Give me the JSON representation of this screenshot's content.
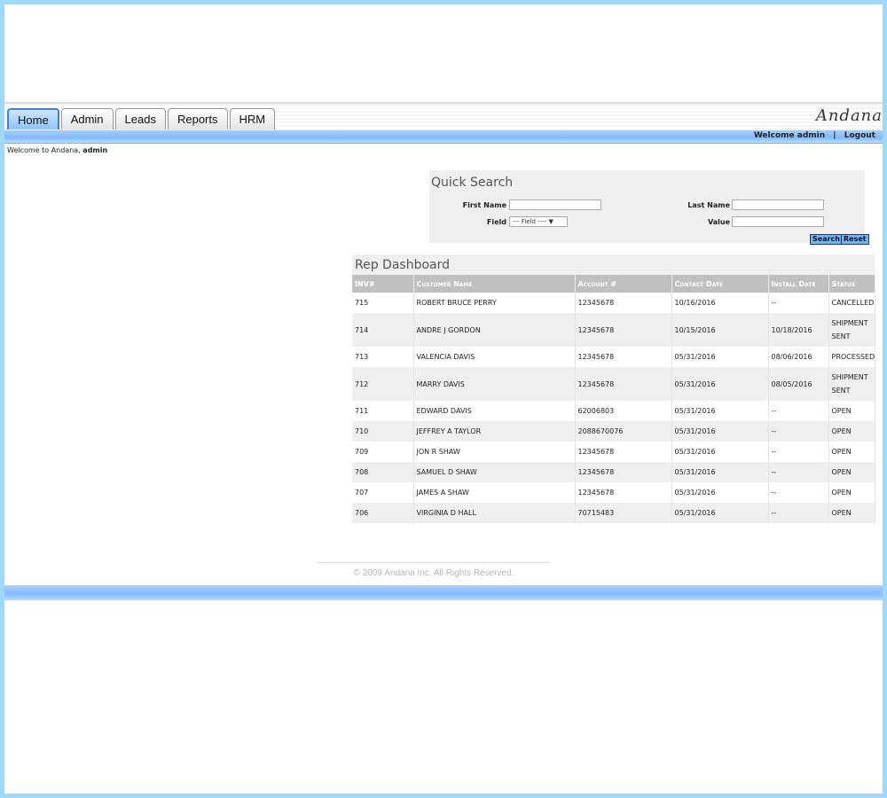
{
  "tabs": [
    {
      "label": "Home",
      "active": true
    },
    {
      "label": "Admin",
      "active": false
    },
    {
      "label": "Leads",
      "active": false
    },
    {
      "label": "Reports",
      "active": false
    },
    {
      "label": "HRM",
      "active": false
    }
  ],
  "logo": "Andana",
  "user": {
    "welcome": "Welcome admin",
    "separator": "|",
    "logout": "Logout"
  },
  "welcome_line": {
    "prefix": "Welcome to Andana,",
    "user": "admin"
  },
  "quick_search": {
    "title": "Quick Search",
    "first_name_label": "First Name",
    "first_name_value": "",
    "last_name_label": "Last Name",
    "last_name_value": "",
    "field_label": "Field",
    "field_selected": "--- Field ---- ▼",
    "value_label": "Value",
    "value_value": "",
    "search_button": "Search",
    "reset_button": "Reset"
  },
  "dashboard": {
    "title": "Rep Dashboard",
    "columns": [
      "INV#",
      "Customer Name",
      "Account #",
      "Contact Date",
      "Install Date",
      "Status"
    ],
    "rows": [
      [
        "715",
        "ROBERT BRUCE PERRY",
        "12345678",
        "10/16/2016",
        "--",
        "CANCELLED"
      ],
      [
        "714",
        "ANDRE J GORDON",
        "12345678",
        "10/15/2016",
        "10/18/2016",
        "SHIPMENT SENT"
      ],
      [
        "713",
        "VALENCIA DAVIS",
        "12345678",
        "05/31/2016",
        "08/06/2016",
        "PROCESSED"
      ],
      [
        "712",
        "MARRY DAVIS",
        "12345678",
        "05/31/2016",
        "08/05/2016",
        "SHIPMENT SENT"
      ],
      [
        "711",
        "EDWARD DAVIS",
        "62006803",
        "05/31/2016",
        "--",
        "OPEN"
      ],
      [
        "710",
        "JEFFREY A TAYLOR",
        "2088670076",
        "05/31/2016",
        "--",
        "OPEN"
      ],
      [
        "709",
        "JON R SHAW",
        "12345678",
        "05/31/2016",
        "--",
        "OPEN"
      ],
      [
        "708",
        "SAMUEL D SHAW",
        "12345678",
        "05/31/2016",
        "--",
        "OPEN"
      ],
      [
        "707",
        "JAMES A SHAW",
        "12345678",
        "05/31/2016",
        "--",
        "OPEN"
      ],
      [
        "706",
        "VIRGINIA D HALL",
        "70715483",
        "05/31/2016",
        "--",
        "OPEN"
      ]
    ]
  },
  "footer": {
    "copyright": "© 2009 Andana Inc. All Rights Reserved."
  }
}
